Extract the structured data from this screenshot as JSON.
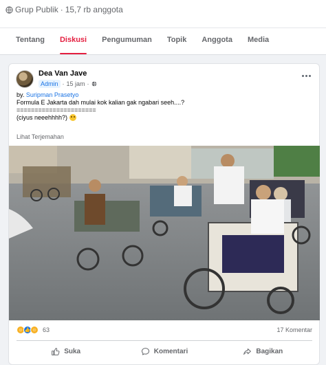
{
  "group": {
    "privacy_label": "Grup Publik",
    "member_count": "15,7 rb anggota",
    "tabs": [
      {
        "label": "Tentang",
        "active": false
      },
      {
        "label": "Diskusi",
        "active": true
      },
      {
        "label": "Pengumuman",
        "active": false
      },
      {
        "label": "Topik",
        "active": false
      },
      {
        "label": "Anggota",
        "active": false
      },
      {
        "label": "Media",
        "active": false
      }
    ],
    "accent_color": "#e41e3f"
  },
  "post": {
    "author": "Dea Van Jave",
    "role_badge": "Admin",
    "time": "15 jam",
    "byline_prefix": "by.",
    "mention": "Suripman Prasetyo",
    "line1": "Formula E Jakarta dah mulai kok kalian gak ngabari seeh....?",
    "line2": "======================",
    "line3": "(ciyus neeehhhh?)",
    "translate_label": "Lihat Terjemahan",
    "photo_icon": "photo-becak-riders",
    "reaction_icons": [
      "haha-icon",
      "like-icon",
      "wow-icon"
    ],
    "reaction_count": "63",
    "comment_count": "17 Komentar",
    "actions": {
      "like": "Suka",
      "comment": "Komentari",
      "share": "Bagikan"
    }
  }
}
